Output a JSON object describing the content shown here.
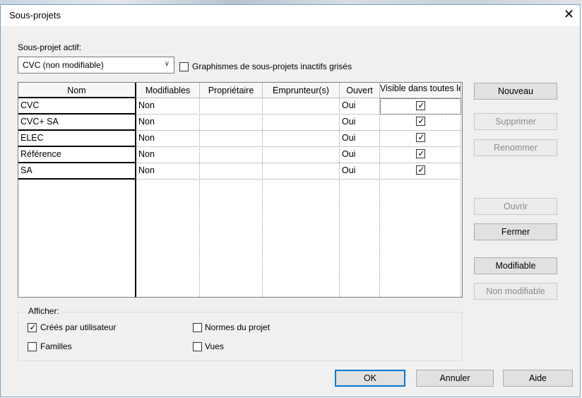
{
  "dialog": {
    "title": "Sous-projets",
    "close_symbol": "✕"
  },
  "active_subproject": {
    "label": "Sous-projet actif:",
    "selected": "CVC (non modifiable)"
  },
  "gray_inactive": {
    "label": "Graphismes de sous-projets inactifs grisés",
    "checked": false
  },
  "table": {
    "headers": {
      "name": "Nom",
      "editable": "Modifiables",
      "owner": "Propriétaire",
      "borrowers": "Emprunteur(s)",
      "opened": "Ouvert",
      "visible": "Visible dans toutes les vues"
    },
    "rows": [
      {
        "name": "CVC",
        "editable": "Non",
        "owner": "",
        "borrowers": "",
        "opened": "Oui",
        "visible": true
      },
      {
        "name": "CVC+ SA",
        "editable": "Non",
        "owner": "",
        "borrowers": "",
        "opened": "Oui",
        "visible": true
      },
      {
        "name": "ELEC",
        "editable": "Non",
        "owner": "",
        "borrowers": "",
        "opened": "Oui",
        "visible": true
      },
      {
        "name": "Référence",
        "editable": "Non",
        "owner": "",
        "borrowers": "",
        "opened": "Oui",
        "visible": true
      },
      {
        "name": "SA",
        "editable": "Non",
        "owner": "",
        "borrowers": "",
        "opened": "Oui",
        "visible": true
      }
    ]
  },
  "side_buttons": {
    "new": "Nouveau",
    "delete": "Supprimer",
    "rename": "Renommer",
    "open": "Ouvrir",
    "close": "Fermer",
    "editable": "Modifiable",
    "non_editable": "Non modifiable"
  },
  "show": {
    "legend": "Afficher:",
    "user_created": {
      "label": "Créés par utilisateur",
      "checked": true
    },
    "families": {
      "label": "Familles",
      "checked": false
    },
    "project_standards": {
      "label": "Normes du projet",
      "checked": false
    },
    "views": {
      "label": "Vues",
      "checked": false
    }
  },
  "footer": {
    "ok": "OK",
    "cancel": "Annuler",
    "help": "Aide"
  },
  "check_glyph": "✓",
  "colors": {
    "default_button_border": "#0078d7",
    "window_background": "#f0f0f0"
  }
}
